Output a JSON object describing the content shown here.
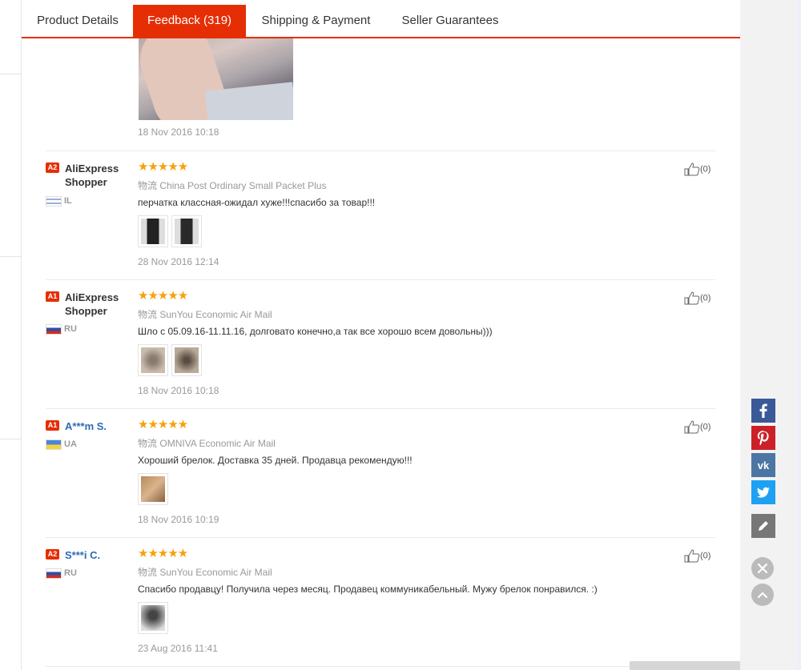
{
  "tabs": [
    {
      "label": "Product Details"
    },
    {
      "label": "Feedback (319)"
    },
    {
      "label": "Shipping & Payment"
    },
    {
      "label": "Seller Guarantees"
    }
  ],
  "active_tab": "Feedback (319)",
  "top_review": {
    "date": "18 Nov 2016 10:18"
  },
  "reviews": [
    {
      "badge": "A2",
      "name": "AliExpress Shopper",
      "country": "IL",
      "stars": "★★★★★",
      "shipping_label": "物流",
      "shipping": "China Post Ordinary Small Packet Plus",
      "comment": "перчатка классная-ожидал хуже!!!спасибо за товар!!!",
      "likes": "(0)",
      "date": "28 Nov 2016 12:14"
    },
    {
      "badge": "A1",
      "name": "AliExpress Shopper",
      "country": "RU",
      "stars": "★★★★★",
      "shipping_label": "物流",
      "shipping": "SunYou Economic Air Mail",
      "comment": "Шло с 05.09.16-11.11.16, долговато конечно,а так все хорошо всем довольны)))",
      "likes": "(0)",
      "date": "18 Nov 2016 10:18"
    },
    {
      "badge": "A1",
      "name": "A***m S.",
      "country": "UA",
      "stars": "★★★★★",
      "shipping_label": "物流",
      "shipping": "OMNIVA Economic Air Mail",
      "comment": "Хороший брелок. Доставка 35 дней. Продавца рекомендую!!!",
      "likes": "(0)",
      "date": "18 Nov 2016 10:19"
    },
    {
      "badge": "A2",
      "name": "S***i C.",
      "country": "RU",
      "stars": "★★★★★",
      "shipping_label": "物流",
      "shipping": "SunYou Economic Air Mail",
      "comment": "Спасибо продавцу! Получила через месяц. Продавец коммуникабельный. Мужу брелок понравился. :)",
      "likes": "(0)",
      "date": "23 Aug 2016 11:41"
    }
  ],
  "colors": {
    "accent": "#e62e04",
    "stars": "#f6a20a",
    "facebook": "#3b5998",
    "pinterest": "#cb2027",
    "vk": "#4c75a3",
    "twitter": "#1da1f2"
  },
  "side_icons": [
    "facebook-icon",
    "pinterest-icon",
    "vk-icon",
    "twitter-icon",
    "edit-icon",
    "close-icon",
    "scroll-up-icon"
  ]
}
